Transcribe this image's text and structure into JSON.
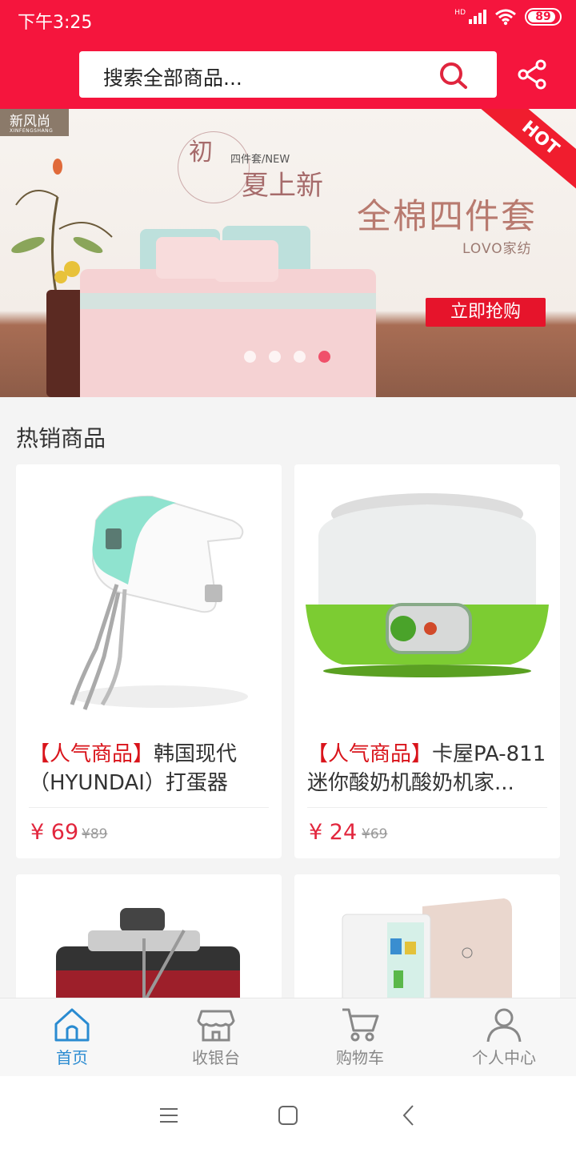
{
  "status_bar": {
    "time": "下午3:25",
    "network": "HD",
    "battery": "89"
  },
  "header": {
    "search_placeholder": "搜索全部商品..."
  },
  "banner": {
    "brand_tag": "新风尚",
    "brand_tag_sub": "XINFENGSHANG",
    "hot": "HOT",
    "small_title_1": "初",
    "small_title_2": "夏上新",
    "small_sub": "四件套/NEW",
    "title": "全棉四件套",
    "brand": "LOVO家纺",
    "button": "立即抢购",
    "slide_count": 4,
    "active_slide": 4
  },
  "section": {
    "title": "热销商品"
  },
  "products": [
    {
      "tag": "【人气商品】",
      "name": "韩国现代（HYUNDAI）打蛋器 电...",
      "price": "¥ 69",
      "old_price": "¥89",
      "image": "hand-mixer"
    },
    {
      "tag": "【人气商品】",
      "name": "卡屋PA-811迷你酸奶机酸奶机家...",
      "price": "¥ 24",
      "old_price": "¥69",
      "image": "yogurt-maker"
    },
    {
      "image": "juicer"
    },
    {
      "image": "mini-fridge"
    }
  ],
  "bottom_nav": [
    {
      "label": "首页",
      "icon": "home-icon",
      "active": true
    },
    {
      "label": "收银台",
      "icon": "store-icon",
      "active": false
    },
    {
      "label": "购物车",
      "icon": "cart-icon",
      "active": false
    },
    {
      "label": "个人中心",
      "icon": "user-icon",
      "active": false
    }
  ],
  "colors": {
    "brand_red": "#f5153d",
    "price_red": "#e2263d",
    "active_blue": "#2a8bd1"
  }
}
